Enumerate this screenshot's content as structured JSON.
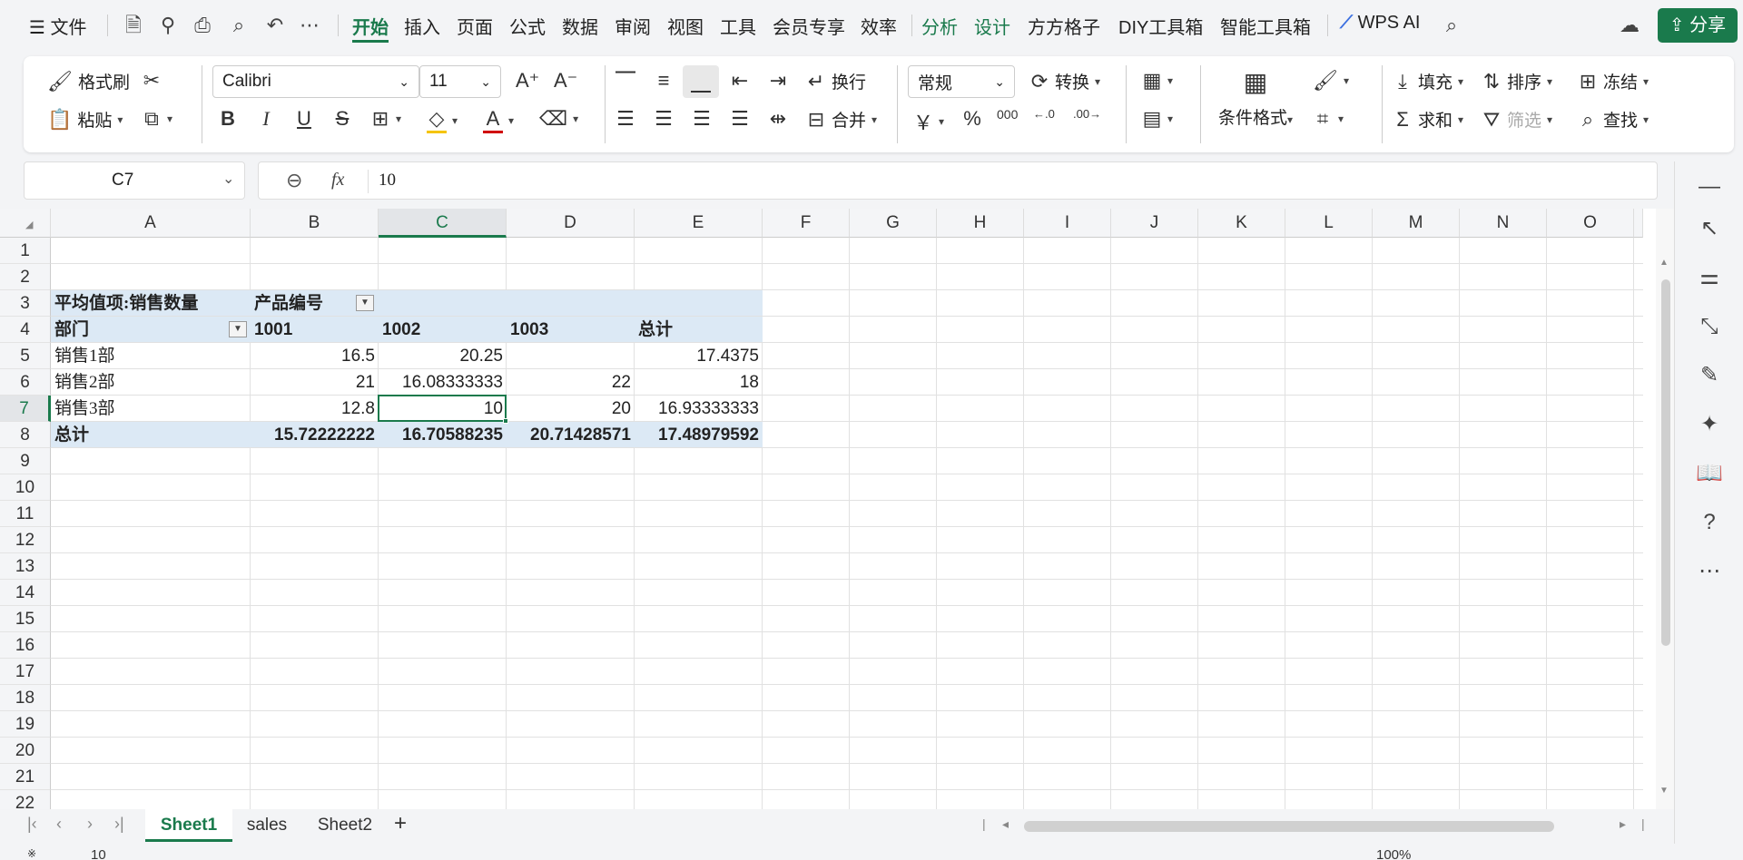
{
  "menubar": {
    "file": "文件",
    "tabs": [
      "开始",
      "插入",
      "页面",
      "公式",
      "数据",
      "审阅",
      "视图",
      "工具",
      "会员专享",
      "效率"
    ],
    "context_tabs": [
      "分析",
      "设计"
    ],
    "plugin_tabs": [
      "方方格子",
      "DIY工具箱",
      "智能工具箱"
    ],
    "wps_ai": "WPS AI",
    "share": "分享"
  },
  "ribbon": {
    "format_painter": "格式刷",
    "paste": "粘贴",
    "font_name": "Calibri",
    "font_size": "11",
    "wrap": "换行",
    "merge": "合并",
    "number_format": "常规",
    "convert": "转换",
    "cond_format": "条件格式",
    "fill": "填充",
    "sort": "排序",
    "freeze": "冻结",
    "sum": "求和",
    "filter": "筛选",
    "find": "查找",
    "bold": "B",
    "italic": "I",
    "underline": "U",
    "strike": "S",
    "yuan": "￥",
    "percent": "%",
    "thousands": "000",
    "dec_inc": "←.0",
    "dec_dec": ".00→"
  },
  "formula_bar": {
    "cell_ref": "C7",
    "fx": "fx",
    "value": "10"
  },
  "columns": [
    "A",
    "B",
    "C",
    "D",
    "E",
    "F",
    "G",
    "H",
    "I",
    "J",
    "K",
    "L",
    "M",
    "N",
    "O"
  ],
  "rows": [
    "1",
    "2",
    "3",
    "4",
    "5",
    "6",
    "7",
    "8",
    "9",
    "10",
    "11",
    "12",
    "13",
    "14",
    "15",
    "16",
    "17",
    "18",
    "19",
    "20",
    "21",
    "22"
  ],
  "pivot": {
    "value_label": "平均值项:销售数量",
    "col_field": "产品编号",
    "row_field": "部门",
    "col_headers": [
      "1001",
      "1002",
      "1003",
      "总计"
    ],
    "rows": [
      {
        "name": "销售1部",
        "values": [
          "16.5",
          "20.25",
          "",
          "17.4375"
        ]
      },
      {
        "name": "销售2部",
        "values": [
          "21",
          "16.08333333",
          "22",
          "18"
        ]
      },
      {
        "name": "销售3部",
        "values": [
          "12.8",
          "10",
          "20",
          "16.93333333"
        ]
      }
    ],
    "total": {
      "name": "总计",
      "values": [
        "15.72222222",
        "16.70588235",
        "20.71428571",
        "17.48979592"
      ]
    }
  },
  "sheet_tabs": [
    "Sheet1",
    "sales",
    "Sheet2"
  ],
  "active_sheet": "Sheet1",
  "status": {
    "value": "10",
    "zoom": "100%"
  },
  "colors": {
    "accent": "#1a7a4c",
    "pivot_header": "#dce9f5"
  }
}
